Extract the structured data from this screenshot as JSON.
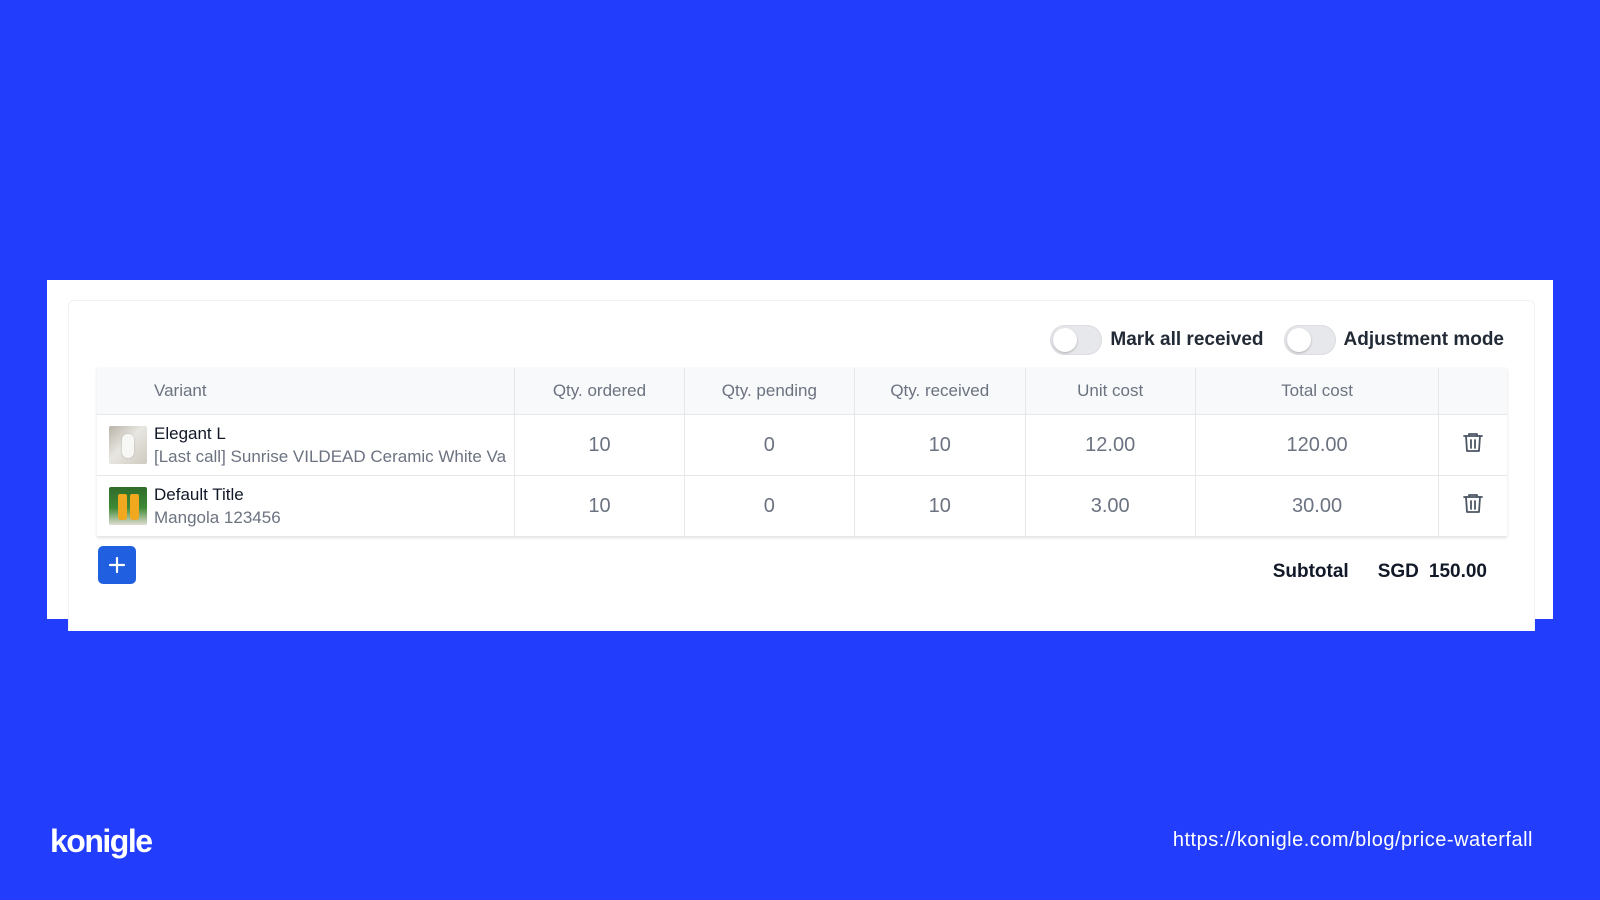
{
  "colors": {
    "background": "#233dfd",
    "ordered": "#f4b829",
    "pending": "#ef4444",
    "received": "#22c55e",
    "add_button": "#1f5fe0"
  },
  "toggles": [
    {
      "label": "Mark all received",
      "on": false
    },
    {
      "label": "Adjustment mode",
      "on": false
    }
  ],
  "table": {
    "headers": [
      "Variant",
      "Qty. ordered",
      "Qty. pending",
      "Qty. received",
      "Unit cost",
      "Total cost"
    ],
    "rows": [
      {
        "thumbnail": "vase-image",
        "title": "Elegant L",
        "subtitle": "[Last call] Sunrise VILDEAD Ceramic White Va",
        "qty_ordered": "10",
        "qty_pending": "0",
        "qty_received": "10",
        "unit_cost": "12.00",
        "total_cost": "120.00",
        "action_icon": "trash-icon"
      },
      {
        "thumbnail": "drinks-image",
        "title": "Default Title",
        "subtitle": "Mangola 123456",
        "qty_ordered": "10",
        "qty_pending": "0",
        "qty_received": "10",
        "unit_cost": "3.00",
        "total_cost": "30.00",
        "action_icon": "trash-icon"
      }
    ]
  },
  "add_button_icon": "plus-icon",
  "subtotal": {
    "label": "Subtotal",
    "currency": "SGD",
    "amount": "150.00"
  },
  "footer": {
    "logo": "konigle",
    "url": "https://konigle.com/blog/price-waterfall"
  }
}
